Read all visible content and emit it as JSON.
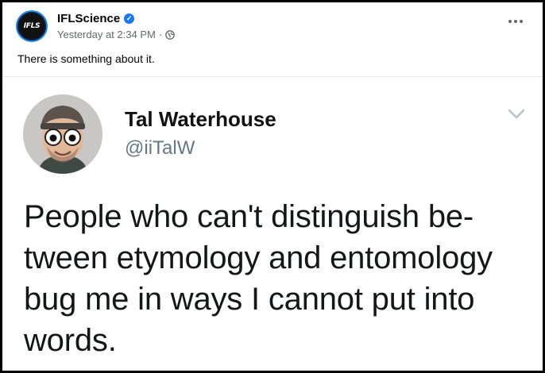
{
  "post": {
    "page_name": "IFLScience",
    "avatar_text": "IFLS",
    "timestamp": "Yesterday at 2:34 PM",
    "meta_separator": "·",
    "caption": "There is something about it."
  },
  "tweet": {
    "author_name": "Tal Waterhouse",
    "author_handle": "@iiTalW",
    "text_lines": [
      "People who can't distinguish be-",
      "tween etymology and entomology",
      "bug me in ways I cannot put into",
      "words."
    ]
  },
  "colors": {
    "verified": "#1877f2",
    "meta_gray": "#65676b",
    "handle_gray": "#657786",
    "frame_border": "#000000"
  },
  "icons": [
    "verified-badge-icon",
    "globe-icon",
    "more-options-icon",
    "chevron-down-icon"
  ]
}
